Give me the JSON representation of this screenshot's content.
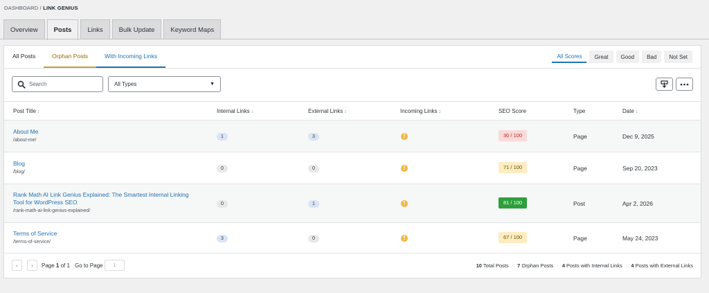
{
  "breadcrumb": {
    "root": "DASHBOARD",
    "separator": "/",
    "current": "LINK GENIUS"
  },
  "top_tabs": [
    "Overview",
    "Posts",
    "Links",
    "Bulk Update",
    "Keyword Maps"
  ],
  "filter_tabs": [
    "All Posts",
    "Orphan Posts",
    "With Incoming Links"
  ],
  "score_tabs": [
    "All Scores",
    "Great",
    "Good",
    "Bad",
    "Not Set"
  ],
  "search": {
    "placeholder": "Search"
  },
  "type_filter": {
    "value": "All Types"
  },
  "icons": {
    "export": "export-icon",
    "more": "more-icon",
    "search": "search-icon",
    "warning": "warning-icon"
  },
  "table": {
    "columns": [
      "Post Title",
      "Internal Links",
      "External Links",
      "Incoming Links",
      "SEO Score",
      "Type",
      "Date"
    ],
    "rows": [
      {
        "title": "About Me",
        "slug": "/about-me/",
        "internal": "1",
        "external": "3",
        "incoming": "!",
        "seo": "30 / 100",
        "type": "Page",
        "date": "Dec 9, 2025"
      },
      {
        "title": "Blog",
        "slug": "/blog/",
        "internal": "0",
        "external": "0",
        "incoming": "!",
        "seo": "71 / 100",
        "type": "Page",
        "date": "Sep 20, 2023"
      },
      {
        "title": "Rank Math AI Link Genius Explained: The Smartest Internal Linking Tool for WordPress SEO",
        "slug": "/rank-math-ai-link-genius-explained/",
        "internal": "0",
        "external": "1",
        "incoming": "!",
        "seo": "81 / 100",
        "type": "Post",
        "date": "Apr 2, 2026"
      },
      {
        "title": "Terms of Service",
        "slug": "/terms-of-service/",
        "internal": "3",
        "external": "0",
        "incoming": "!",
        "seo": "67 / 100",
        "type": "Page",
        "date": "May 24, 2023"
      }
    ]
  },
  "pagination": {
    "prev": "‹",
    "next": "›",
    "page_label": "Page",
    "current": "1",
    "of_label": "of",
    "total": "1",
    "goto_label": "Go to Page",
    "goto_value": "1"
  },
  "stats": [
    {
      "count": "10",
      "label": "Total Posts"
    },
    {
      "count": "7",
      "label": "Orphan Posts"
    },
    {
      "count": "4",
      "label": "Posts with Internal Links"
    },
    {
      "count": "4",
      "label": "Posts with External Links"
    }
  ],
  "colors": {
    "accent": "#2271b1",
    "orphan": "#9a6700",
    "seo_bad": "#b32d2e",
    "seo_ok": "#fcecc1",
    "seo_good": "#2e9f3a",
    "warning": "#f0b849"
  }
}
